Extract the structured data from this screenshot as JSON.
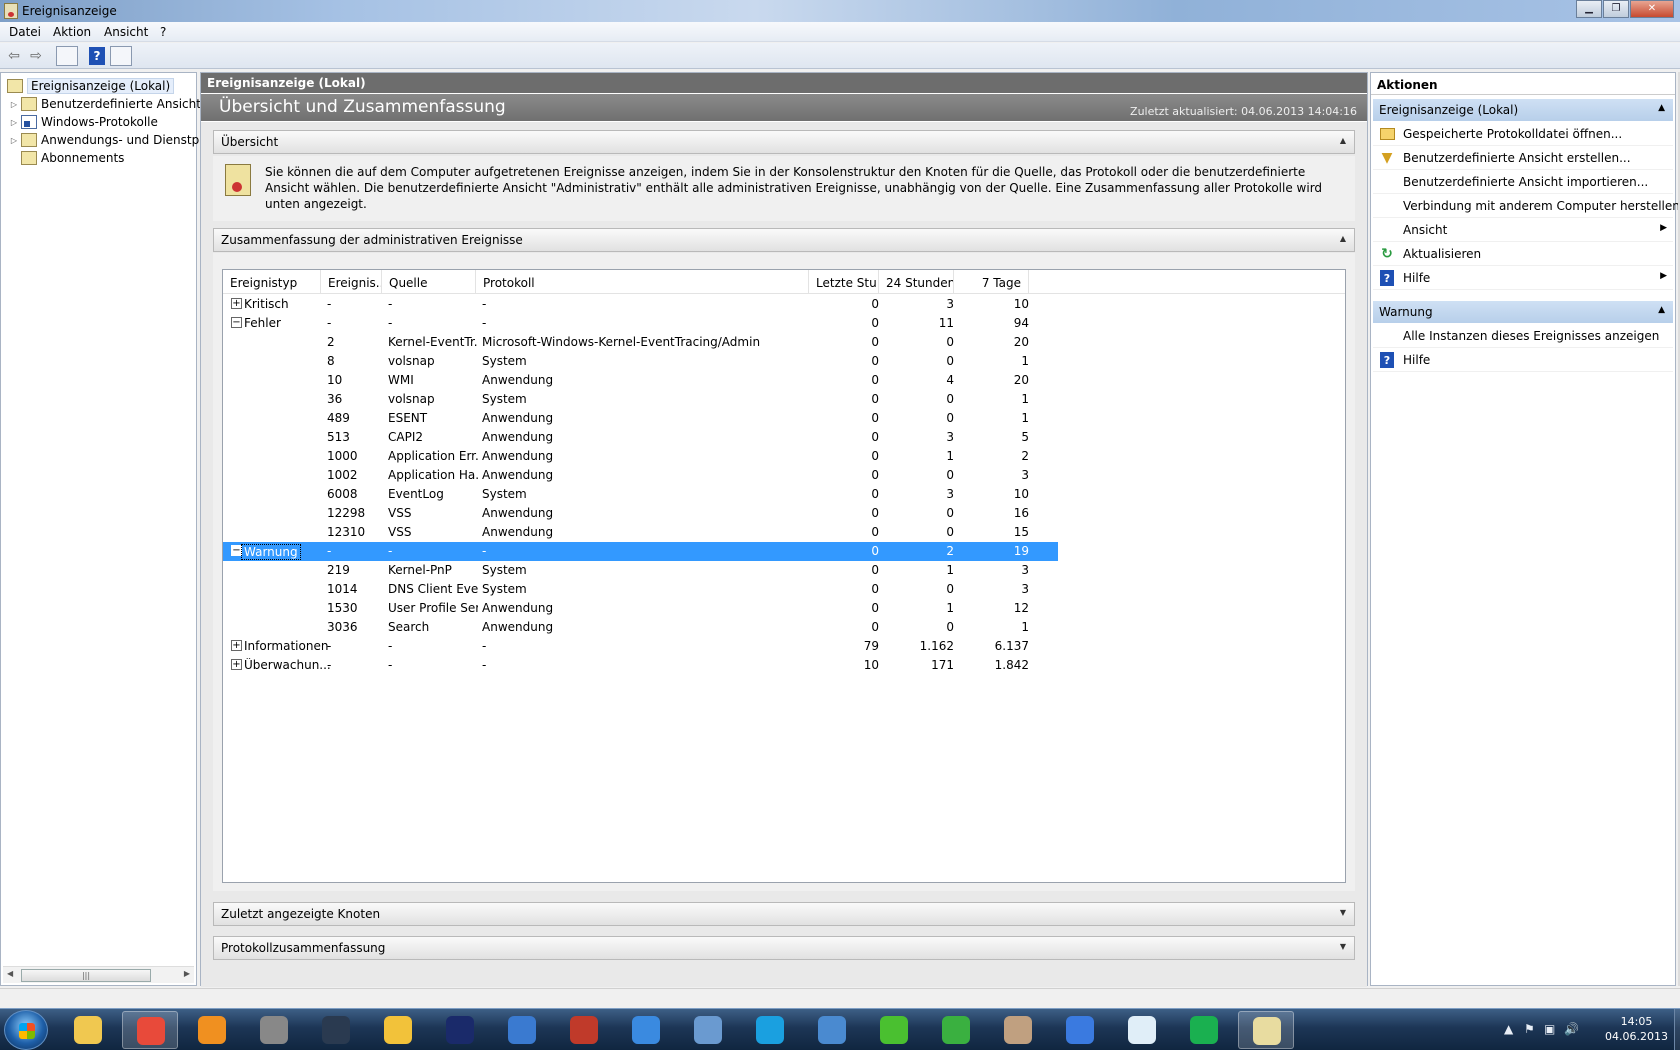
{
  "window": {
    "title": "Ereignisanzeige",
    "buttons": {
      "minimize": "▁",
      "maximize": "❐",
      "close": "✕"
    }
  },
  "menu": [
    "Datei",
    "Aktion",
    "Ansicht",
    "?"
  ],
  "toolbar": {
    "back": "⇦",
    "forward": "⇨",
    "help": "?"
  },
  "tree": {
    "items": [
      {
        "label": "Ereignisanzeige (Lokal)",
        "icon": "event-viewer-icon"
      },
      {
        "label": "Benutzerdefinierte Ansichten",
        "icon": "folder-icon"
      },
      {
        "label": "Windows-Protokolle",
        "icon": "logs-icon"
      },
      {
        "label": "Anwendungs- und Dienstprotokolle",
        "icon": "folder-icon"
      },
      {
        "label": "Abonnements",
        "icon": "subscriptions-icon"
      }
    ],
    "scroll_grip": "|||"
  },
  "center": {
    "header": "Ereignisanzeige (Lokal)",
    "band_title": "Übersicht und Zusammenfassung",
    "last_updated": "Zuletzt aktualisiert: 04.06.2013 14:04:16",
    "overview_title": "Übersicht",
    "overview_text": "Sie können die auf dem Computer aufgetretenen Ereignisse anzeigen, indem Sie in der Konsolenstruktur den Knoten für die Quelle, das Protokoll oder die benutzerdefinierte Ansicht wählen. Die benutzerdefinierte Ansicht \"Administrativ\" enthält alle administrativen Ereignisse, unabhängig von der Quelle. Eine Zusammenfassung aller Protokolle wird unten angezeigt.",
    "summary_title": "Zusammenfassung der administrativen Ereignisse",
    "recent_nodes_title": "Zuletzt angezeigte Knoten",
    "log_summary_title": "Protokollzusammenfassung",
    "caret_up": "▲",
    "caret_down": "▼"
  },
  "table": {
    "columns": [
      "Ereignistyp",
      "Ereignis...",
      "Quelle",
      "Protokoll",
      "Letzte Stu...",
      "24 Stunden",
      "7 Tage"
    ],
    "rows": [
      {
        "type": "Kritisch",
        "expander": "+",
        "id": "-",
        "source": "-",
        "log": "-",
        "h1": "0",
        "h24": "3",
        "d7": "10"
      },
      {
        "type": "Fehler",
        "expander": "−",
        "id": "-",
        "source": "-",
        "log": "-",
        "h1": "0",
        "h24": "11",
        "d7": "94"
      },
      {
        "type": "",
        "id": "2",
        "source": "Kernel-EventTr...",
        "log": "Microsoft-Windows-Kernel-EventTracing/Admin",
        "h1": "0",
        "h24": "0",
        "d7": "20"
      },
      {
        "type": "",
        "id": "8",
        "source": "volsnap",
        "log": "System",
        "h1": "0",
        "h24": "0",
        "d7": "1"
      },
      {
        "type": "",
        "id": "10",
        "source": "WMI",
        "log": "Anwendung",
        "h1": "0",
        "h24": "4",
        "d7": "20"
      },
      {
        "type": "",
        "id": "36",
        "source": "volsnap",
        "log": "System",
        "h1": "0",
        "h24": "0",
        "d7": "1"
      },
      {
        "type": "",
        "id": "489",
        "source": "ESENT",
        "log": "Anwendung",
        "h1": "0",
        "h24": "0",
        "d7": "1"
      },
      {
        "type": "",
        "id": "513",
        "source": "CAPI2",
        "log": "Anwendung",
        "h1": "0",
        "h24": "3",
        "d7": "5"
      },
      {
        "type": "",
        "id": "1000",
        "source": "Application Err...",
        "log": "Anwendung",
        "h1": "0",
        "h24": "1",
        "d7": "2"
      },
      {
        "type": "",
        "id": "1002",
        "source": "Application Ha...",
        "log": "Anwendung",
        "h1": "0",
        "h24": "0",
        "d7": "3"
      },
      {
        "type": "",
        "id": "6008",
        "source": "EventLog",
        "log": "System",
        "h1": "0",
        "h24": "3",
        "d7": "10"
      },
      {
        "type": "",
        "id": "12298",
        "source": "VSS",
        "log": "Anwendung",
        "h1": "0",
        "h24": "0",
        "d7": "16"
      },
      {
        "type": "",
        "id": "12310",
        "source": "VSS",
        "log": "Anwendung",
        "h1": "0",
        "h24": "0",
        "d7": "15"
      },
      {
        "type": "Warnung",
        "expander": "−",
        "selected": true,
        "id": "-",
        "source": "-",
        "log": "-",
        "h1": "0",
        "h24": "2",
        "d7": "19"
      },
      {
        "type": "",
        "id": "219",
        "source": "Kernel-PnP",
        "log": "System",
        "h1": "0",
        "h24": "1",
        "d7": "3"
      },
      {
        "type": "",
        "id": "1014",
        "source": "DNS Client Eve...",
        "log": "System",
        "h1": "0",
        "h24": "0",
        "d7": "3"
      },
      {
        "type": "",
        "id": "1530",
        "source": "User Profile Ser...",
        "log": "Anwendung",
        "h1": "0",
        "h24": "1",
        "d7": "12"
      },
      {
        "type": "",
        "id": "3036",
        "source": "Search",
        "log": "Anwendung",
        "h1": "0",
        "h24": "0",
        "d7": "1"
      },
      {
        "type": "Informationen",
        "expander": "+",
        "id": "-",
        "source": "-",
        "log": "-",
        "h1": "79",
        "h24": "1.162",
        "d7": "6.137"
      },
      {
        "type": "Überwachun...",
        "expander": "+",
        "id": "-",
        "source": "-",
        "log": "-",
        "h1": "10",
        "h24": "171",
        "d7": "1.842"
      }
    ]
  },
  "actions": {
    "title": "Aktionen",
    "group1": "Ereignisanzeige (Lokal)",
    "group1_items": [
      {
        "label": "Gespeicherte Protokolldatei öffnen...",
        "icon": "open-folder-icon"
      },
      {
        "label": "Benutzerdefinierte Ansicht erstellen...",
        "icon": "filter-icon"
      },
      {
        "label": "Benutzerdefinierte Ansicht importieren...",
        "icon": ""
      },
      {
        "label": "Verbindung mit anderem Computer herstellen...",
        "icon": ""
      },
      {
        "label": "Ansicht",
        "icon": "",
        "submenu": "▶"
      },
      {
        "label": "Aktualisieren",
        "icon": "refresh-icon"
      },
      {
        "label": "Hilfe",
        "icon": "help-icon",
        "submenu": "▶"
      }
    ],
    "group2": "Warnung",
    "group2_items": [
      {
        "label": "Alle Instanzen dieses Ereignisses anzeigen",
        "icon": ""
      },
      {
        "label": "Hilfe",
        "icon": "help-icon"
      }
    ]
  },
  "taskbar": {
    "apps": [
      "windows-explorer-icon",
      "chrome-icon",
      "media-player-icon",
      "satellite-icon",
      "steam-icon",
      "winamp-icon",
      "avatar-app-icon",
      "calculator-icon",
      "ccleaner-icon",
      "security-shield-icon",
      "remote-desktop-icon",
      "skype-icon",
      "cd-burner-icon",
      "icq-icon",
      "play-icon",
      "photo-app-icon",
      "thunder-icon",
      "wunderlist-icon",
      "spotify-icon",
      "event-viewer-icon"
    ],
    "app_colors": [
      "#f0c850",
      "#e84a3a",
      "#f09020",
      "#888888",
      "#2a3a50",
      "#f2c23a",
      "#1a2a6a",
      "#3a7ad0",
      "#c03a2a",
      "#3a8ae0",
      "#6a9ad0",
      "#1aa0e0",
      "#4a8ad0",
      "#4ac030",
      "#3ab040",
      "#c0a080",
      "#3a7ae0",
      "#e0eef8",
      "#1ab050",
      "#e8dca0"
    ],
    "tray_icons": [
      "▲",
      "⚑",
      "▣",
      "🔊"
    ],
    "clock_time": "14:05",
    "clock_date": "04.06.2013"
  }
}
